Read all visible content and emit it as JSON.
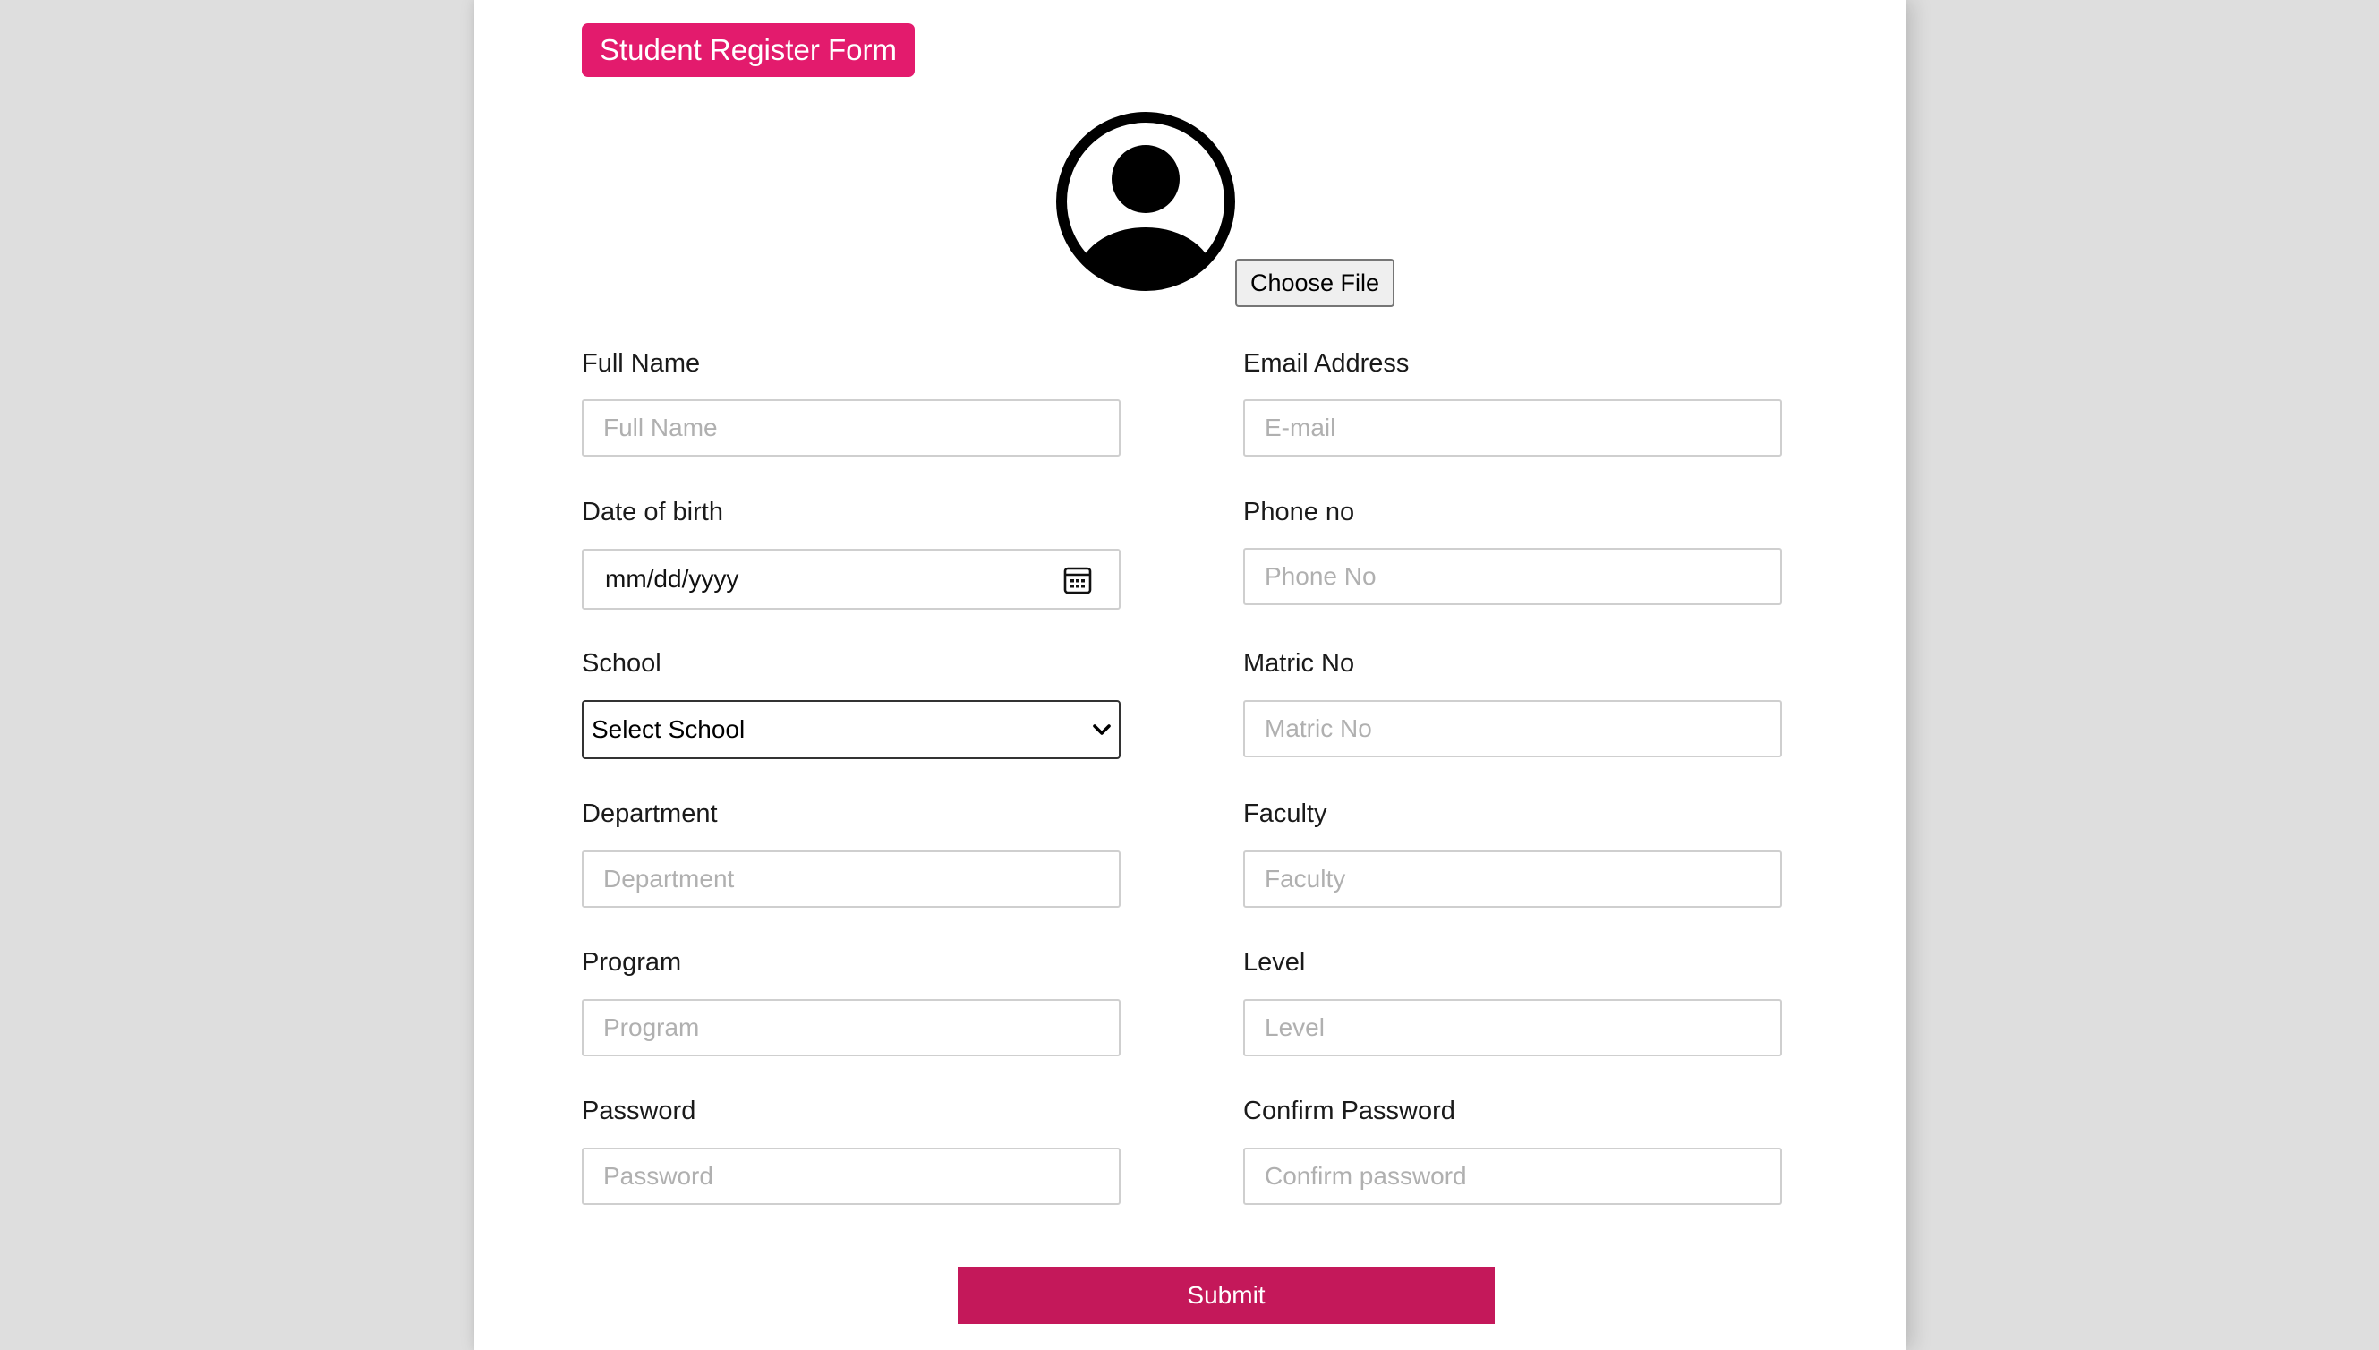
{
  "form": {
    "title": "Student Register Form",
    "file_button_label": "Choose File",
    "submit_label": "Submit"
  },
  "fields": {
    "full_name": {
      "label": "Full Name",
      "placeholder": "Full Name"
    },
    "email": {
      "label": "Email Address",
      "placeholder": "E-mail"
    },
    "dob": {
      "label": "Date of birth",
      "value": "mm/dd/yyyy"
    },
    "phone": {
      "label": "Phone no",
      "placeholder": "Phone No"
    },
    "school": {
      "label": "School",
      "selected": "Select School"
    },
    "matric": {
      "label": "Matric No",
      "placeholder": "Matric No"
    },
    "department": {
      "label": "Department",
      "placeholder": "Department"
    },
    "faculty": {
      "label": "Faculty",
      "placeholder": "Faculty"
    },
    "program": {
      "label": "Program",
      "placeholder": "Program"
    },
    "level": {
      "label": "Level",
      "placeholder": "Level"
    },
    "password": {
      "label": "Password",
      "placeholder": "Password"
    },
    "confirm_password": {
      "label": "Confirm Password",
      "placeholder": "Confirm password"
    }
  },
  "icons": {
    "avatar": "user-circle-icon",
    "date_picker": "calendar-icon",
    "dropdown": "chevron-down-icon"
  },
  "colors": {
    "accent": "#e31b6d",
    "submit": "#c4185a",
    "page_background": "#dedede"
  }
}
